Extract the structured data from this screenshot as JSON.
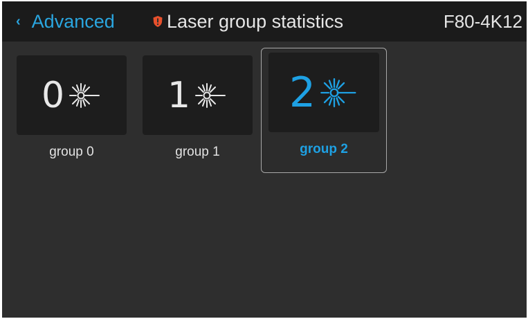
{
  "header": {
    "back_icon": "chevron-left-icon",
    "back_label": "Advanced",
    "status_icon": "shield-warning-icon",
    "title": "Laser group statistics",
    "model": "F80-4K12"
  },
  "groups": [
    {
      "number": "0",
      "label": "group 0",
      "icon": "laser-icon",
      "selected": false
    },
    {
      "number": "1",
      "label": "group 1",
      "icon": "laser-icon",
      "selected": false
    },
    {
      "number": "2",
      "label": "group 2",
      "icon": "laser-icon",
      "selected": true
    }
  ],
  "colors": {
    "accent": "#1ea1e4",
    "background": "#2e2e2e",
    "topbar": "#1b1b1b",
    "tile": "#1d1d1d",
    "warning": "#e8502c"
  }
}
